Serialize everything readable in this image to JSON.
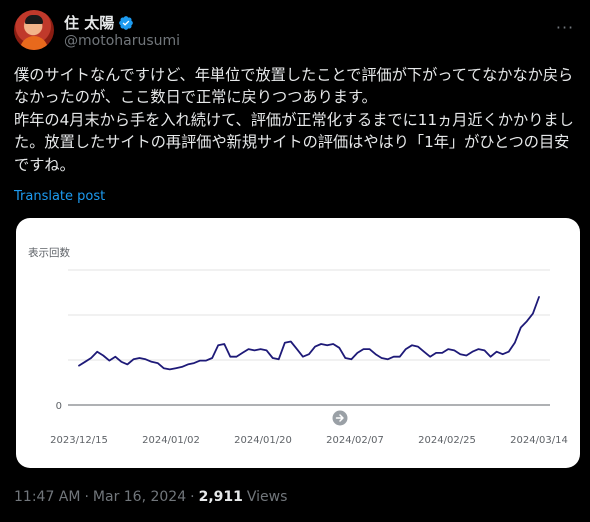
{
  "author": {
    "display_name": "住 太陽",
    "handle": "@motoharusumi"
  },
  "more_label": "···",
  "tweet_text": "僕のサイトなんですけど、年単位で放置したことで評価が下がっててなかなか戻らなかったのが、ここ数日で正常に戻りつつあります。\n昨年の4月末から手を入れ続けて、評価が正常化するまでに11ヵ月近くかかりました。放置したサイトの再評価や新規サイトの評価はやはり「1年」がひとつの目安ですね。",
  "translate_label": "Translate post",
  "chart_data": {
    "type": "line",
    "ylabel": "表示回数",
    "yticks": [
      "0"
    ],
    "ylim": [
      0,
      100
    ],
    "x_tick_labels": [
      "2023/12/15",
      "2024/01/02",
      "2024/01/20",
      "2024/02/07",
      "2024/02/25",
      "2024/03/14"
    ],
    "series": [
      {
        "values": [
          31,
          34,
          37,
          42,
          39,
          35,
          38,
          34,
          32,
          36,
          37,
          36,
          34,
          33,
          29,
          28,
          29,
          30,
          32,
          33,
          35,
          35,
          37,
          47,
          48,
          38,
          38,
          41,
          44,
          43,
          44,
          43,
          37,
          36,
          49,
          50,
          44,
          38,
          40,
          46,
          48,
          47,
          48,
          45,
          37,
          36,
          41,
          44,
          44,
          40,
          37,
          36,
          38,
          38,
          44,
          47,
          46,
          42,
          38,
          41,
          41,
          44,
          43,
          40,
          39,
          42,
          44,
          43,
          38,
          42,
          40,
          42,
          49,
          61,
          66,
          72,
          85
        ]
      }
    ],
    "color": "#1e1a78",
    "grid": true
  },
  "footer": {
    "time": "11:47 AM",
    "separator": "·",
    "date": "Mar 16, 2024",
    "views_count": "2,911",
    "views_label": "Views"
  },
  "colors": {
    "background": "#000000",
    "link": "#1d9bf0",
    "verified": "#1d9bf0",
    "muted": "#71767b"
  }
}
